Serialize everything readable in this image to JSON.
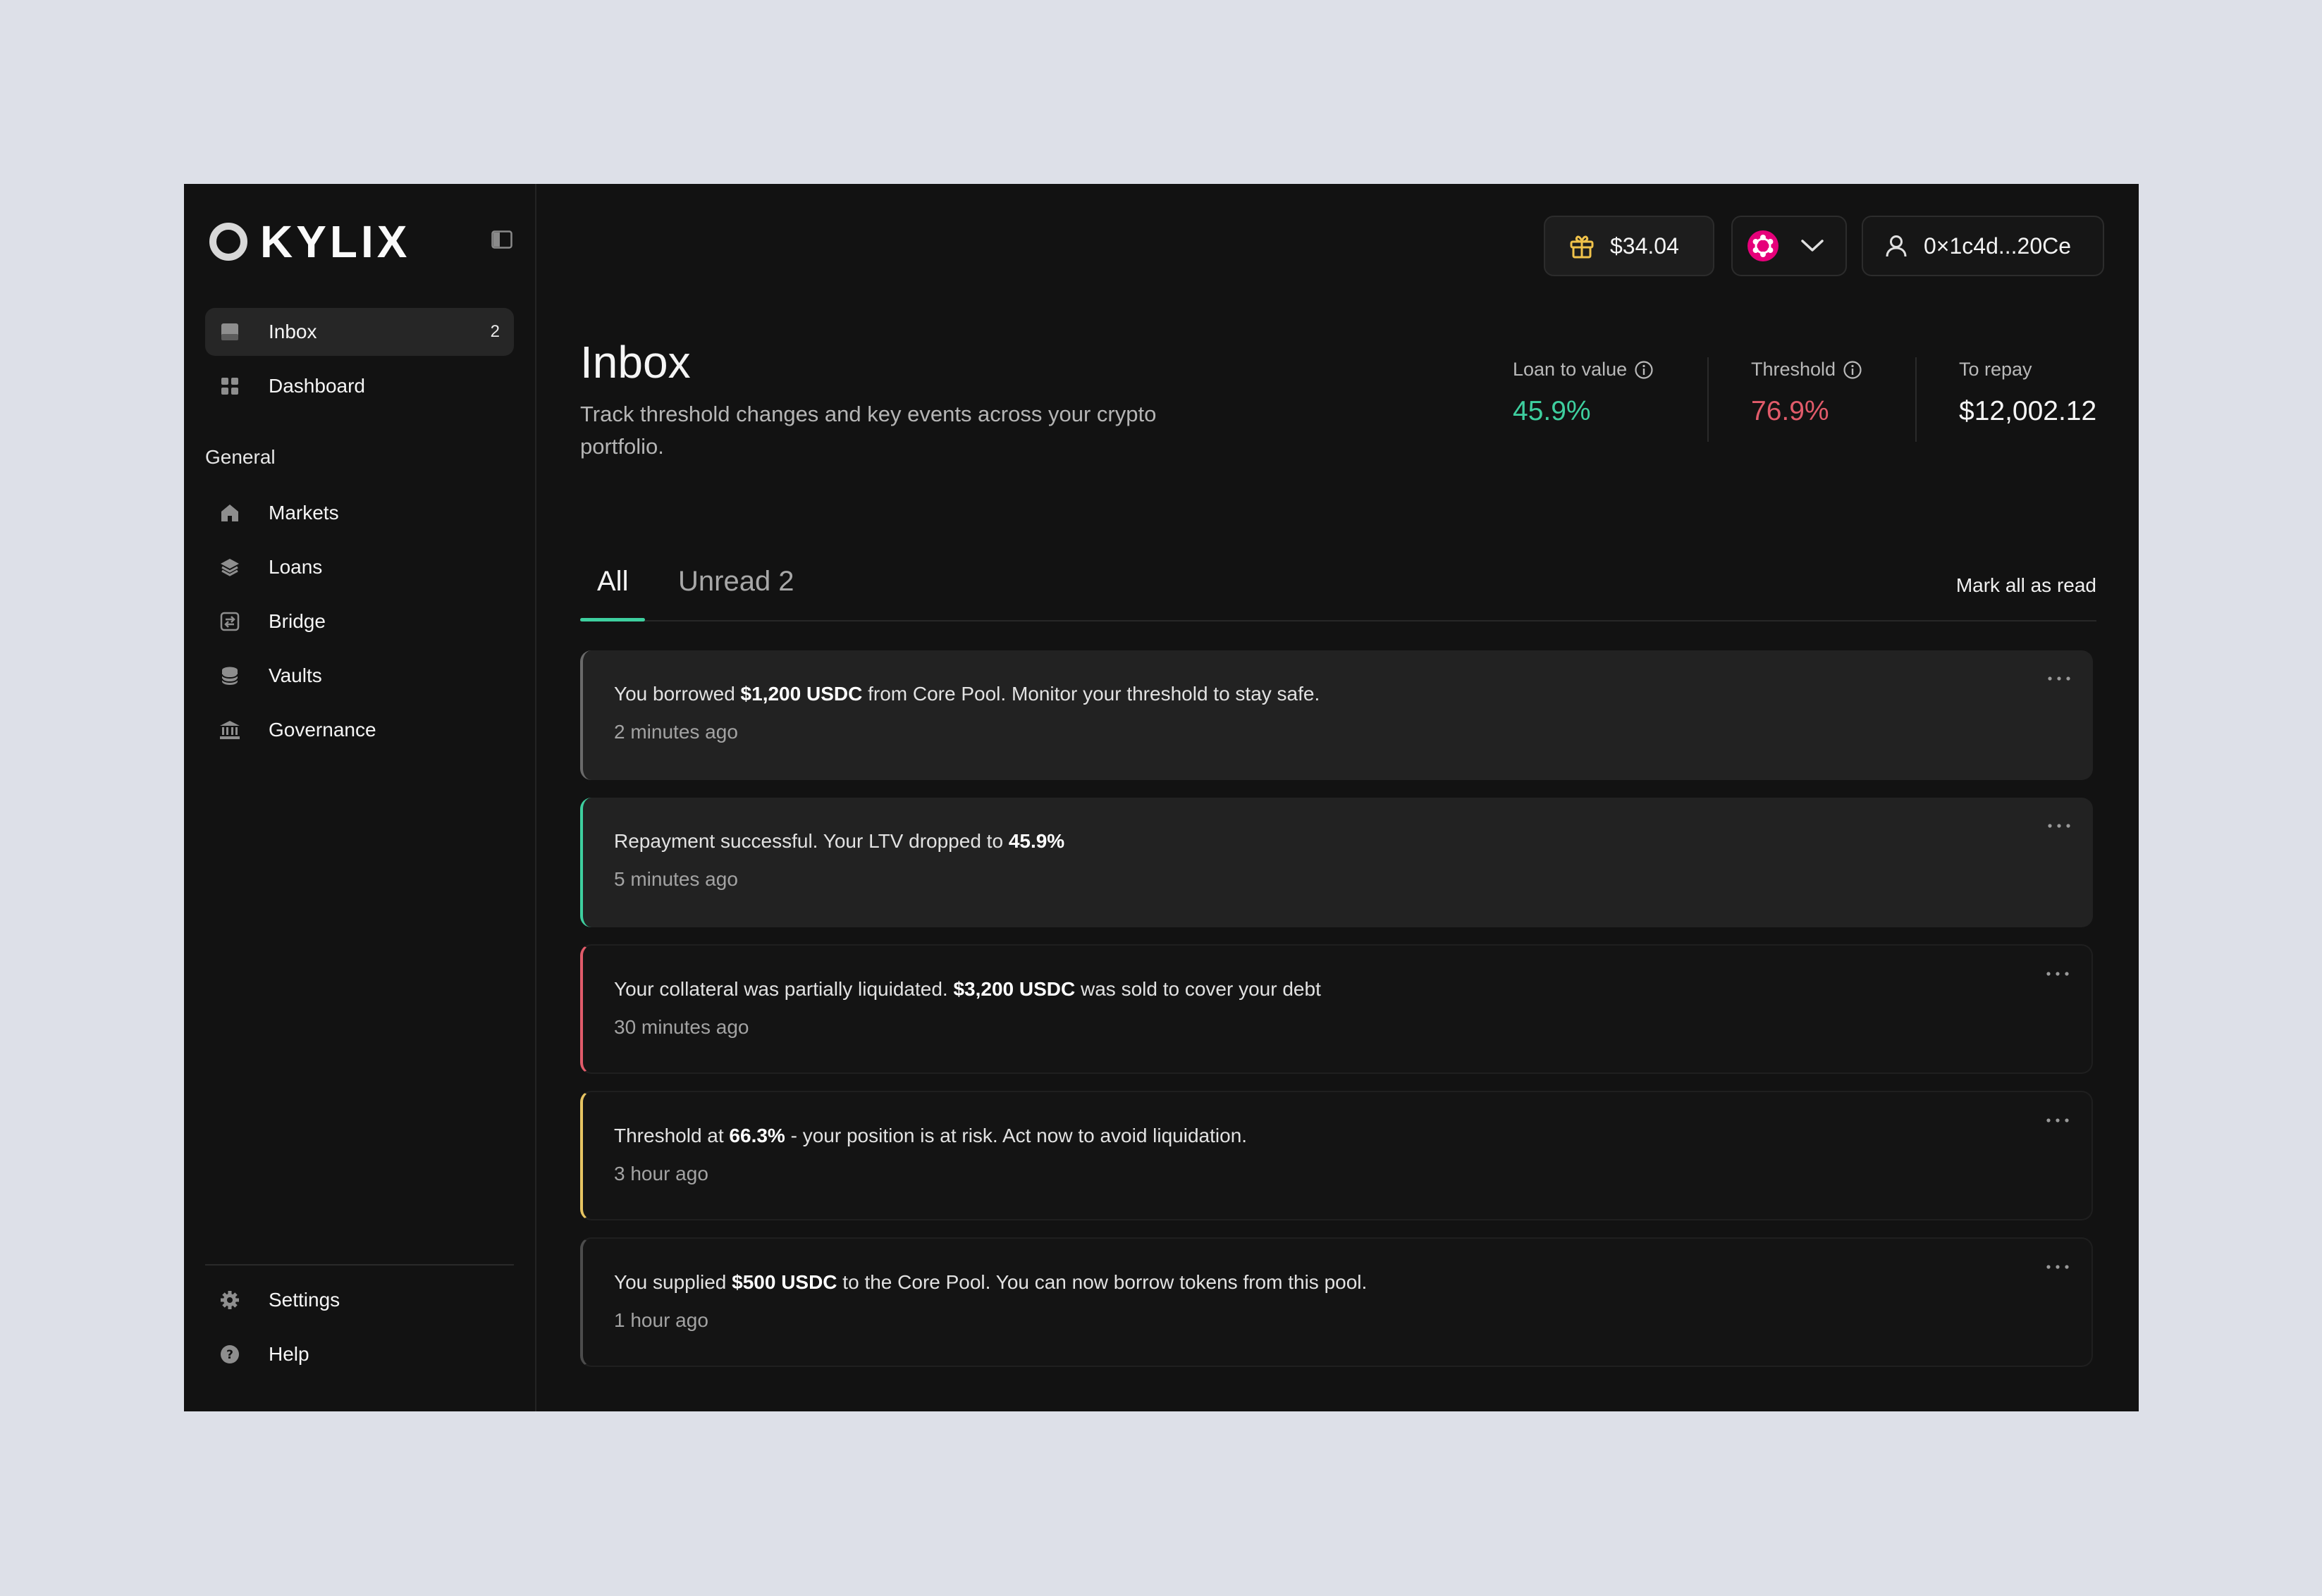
{
  "brand": {
    "name": "KYLIX"
  },
  "sidebar": {
    "primary": [
      {
        "label": "Inbox",
        "count": "2",
        "icon": "inbox-icon",
        "active": true
      },
      {
        "label": "Dashboard",
        "icon": "dashboard-icon"
      }
    ],
    "section_label": "General",
    "general": [
      {
        "label": "Markets",
        "icon": "home-icon"
      },
      {
        "label": "Loans",
        "icon": "layers-icon"
      },
      {
        "label": "Bridge",
        "icon": "bridge-icon"
      },
      {
        "label": "Vaults",
        "icon": "database-icon"
      },
      {
        "label": "Governance",
        "icon": "bank-icon"
      }
    ],
    "footer": [
      {
        "label": "Settings",
        "icon": "gear-icon"
      },
      {
        "label": "Help",
        "icon": "help-icon"
      }
    ]
  },
  "topbar": {
    "reward_amount": "$34.04",
    "wallet_address": "0×1c4d...20Ce"
  },
  "page": {
    "title": "Inbox",
    "subtitle": "Track threshold changes and key events across your crypto portfolio."
  },
  "stats": {
    "ltv": {
      "label": "Loan to value",
      "value": "45.9%",
      "color": "#3ecf9f"
    },
    "threshold": {
      "label": "Threshold",
      "value": "76.9%",
      "color": "#e15b6a"
    },
    "repay": {
      "label": "To repay",
      "value": "$12,002.12",
      "color": "#f5f5f5"
    }
  },
  "tabs": {
    "all": "All",
    "unread": "Unread 2",
    "mark_all": "Mark all as read"
  },
  "notifications": [
    {
      "before": "You borrowed ",
      "bold": "$1,200 USDC",
      "after": " from Core Pool. Monitor your threshold to stay safe.",
      "time": "2 minutes ago",
      "accent": "#6a6a6a"
    },
    {
      "before": "Repayment successful. Your LTV dropped to ",
      "bold": "45.9%",
      "after": "",
      "time": "5 minutes ago",
      "accent": "#3ecf9f"
    },
    {
      "before": "Your collateral was partially liquidated. ",
      "bold": "$3,200 USDC",
      "after": " was sold to cover your debt",
      "time": "30 minutes ago",
      "accent": "#e15b6a"
    },
    {
      "before": "Threshold at ",
      "bold": "66.3%",
      "after": " - your position is at risk. Act now to avoid liquidation.",
      "time": "3 hour ago",
      "accent": "#e6c462"
    },
    {
      "before": "You supplied ",
      "bold": "$500 USDC",
      "after": " to the Core Pool. You can now borrow tokens from this pool.",
      "time": "1 hour ago",
      "accent": "#4c4c4c"
    }
  ]
}
